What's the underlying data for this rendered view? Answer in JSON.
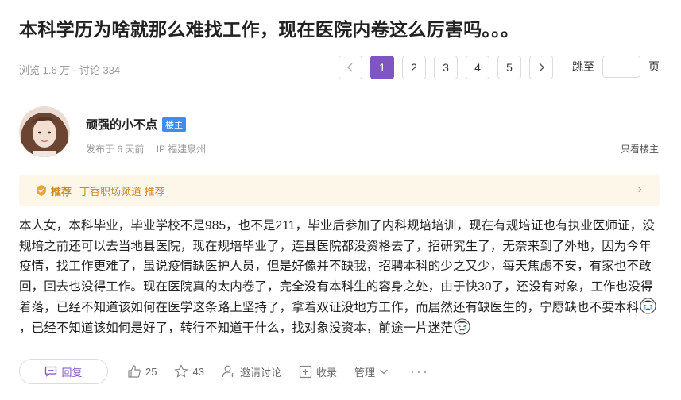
{
  "thread": {
    "title": "本科学历为啥就那么难找工作，现在医院内卷这么厉害吗。。。",
    "stats": "浏览 1.6 万 · 讨论 334"
  },
  "pagination": {
    "prev": "<",
    "pages": [
      "1",
      "2",
      "3",
      "4",
      "5"
    ],
    "active_page": "1",
    "next": ">",
    "jump_label": "跳至",
    "jump_suffix": "页",
    "jump_value": ""
  },
  "post": {
    "author": "顽强的小不点",
    "badge": "楼主",
    "posted": "发布于 6 天前",
    "ip": "IP 福建泉州",
    "only_op": "只看楼主",
    "recommend": {
      "tag": "推荐",
      "text": "丁香职场频道 推荐",
      "arrow": "›"
    },
    "body_part1": "本人女，本科毕业，毕业学校不是985，也不是211，毕业后参加了内科规培培训，现在有规培证也有执业医师证，没规培之前还可以去当地县医院，现在规培毕业了，连县医院都没资格去了，招研究生了，无奈来到了外地，因为今年疫情，找工作更难了，虽说疫情缺医护人员，但是好像并不缺我，招聘本科的少之又少，每天焦虑不安，有家也不敢回，回去也没得工作。现在医院真的太内卷了，完全没有本科生的容身之处，由于快30了，还没有对象，工作也没得着落，已经不知道该如何在医学这条路上坚持了，拿着双证没地方工作，而居然还有缺医生的，宁愿缺也不要本科",
    "body_part2": "，已经不知道该如何是好了，转行不知道干什么，找对象没资本，前途一片迷茫",
    "emoji": "crying-face-icon"
  },
  "actions": {
    "reply": "回复",
    "likes": "25",
    "stars": "43",
    "invite": "邀请讨论",
    "collect": "收录",
    "manage": "管理",
    "more": "···"
  },
  "colors": {
    "accent": "#7f55c2",
    "badge": "#3d8df0",
    "recommend_bg": "#fdf7ea",
    "recommend_text": "#c98a1e"
  }
}
